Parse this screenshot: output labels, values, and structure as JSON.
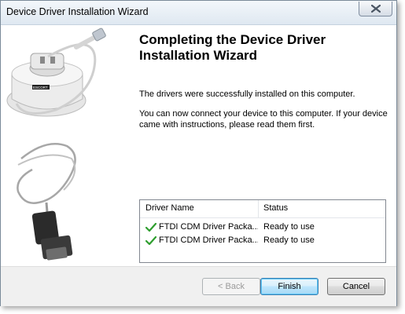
{
  "window": {
    "title": "Device Driver Installation Wizard",
    "close_icon": "close-icon"
  },
  "side_images": {
    "top_image": "usb-cradle-image",
    "bottom_image": "serial-cable-image",
    "brand_text": "ESCORT"
  },
  "main": {
    "heading": "Completing the Device Driver Installation Wizard",
    "message1": "The drivers were successfully installed on this computer.",
    "message2": "You can now connect your device to this computer. If your device came with instructions, please read them first."
  },
  "drivers_table": {
    "columns": [
      "Driver Name",
      "Status"
    ],
    "rows": [
      {
        "name": "FTDI CDM Driver Packa...",
        "status": "Ready to use",
        "icon": "check-icon"
      },
      {
        "name": "FTDI CDM Driver Packa...",
        "status": "Ready to use",
        "icon": "check-icon"
      }
    ]
  },
  "buttons": {
    "back": "< Back",
    "finish": "Finish",
    "cancel": "Cancel"
  },
  "colors": {
    "check": "#2e9e2e",
    "finish_border": "#3c7fb1"
  }
}
